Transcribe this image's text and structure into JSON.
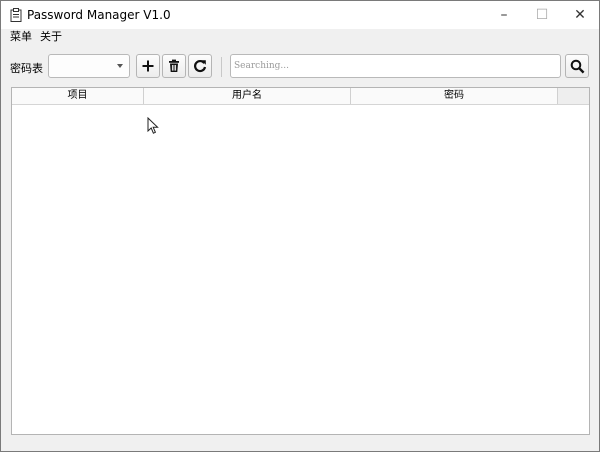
{
  "window": {
    "title": "Password Manager V1.0",
    "controls": {
      "minimize": "–",
      "maximize": "☐",
      "close": "✕"
    }
  },
  "menubar": {
    "items": [
      "菜单",
      "关于"
    ]
  },
  "toolbar": {
    "table_label": "密码表",
    "table_select_value": "",
    "add_icon": "plus-icon",
    "delete_icon": "trash-icon",
    "refresh_icon": "refresh-icon",
    "search_placeholder": "Searching...",
    "search_icon": "search-icon"
  },
  "table": {
    "columns": [
      "项目",
      "用户名",
      "密码"
    ],
    "rows": []
  }
}
